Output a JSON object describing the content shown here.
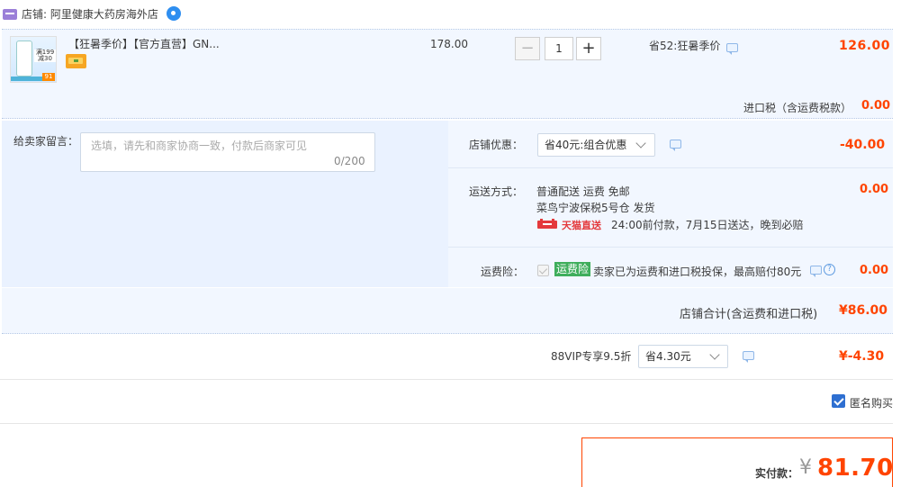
{
  "shop": {
    "name": "店铺: 阿里健康大药房海外店"
  },
  "item": {
    "title": "【狂暑季价】【官方直营】GN...",
    "thumb_label": "满199 减30",
    "thumb_badge": "91",
    "unit_price": "178.00",
    "quantity": "1",
    "promo": "省52:狂暑季价",
    "total": "126.00"
  },
  "tax": {
    "label": "进口税（含运费税款）",
    "value": "0.00"
  },
  "message": {
    "label": "给卖家留言：",
    "placeholder": "选填，请先和商家协商一致，付款后商家可见",
    "count": "0/200"
  },
  "shop_discount": {
    "label": "店铺优惠：",
    "selected": "省40元:组合优惠",
    "value": "-40.00"
  },
  "shipping": {
    "label": "运送方式：",
    "line1": "普通配送 运费 免邮",
    "line2": "菜鸟宁波保税5号仓   发货",
    "tmall_tag": "天猫直送",
    "line3": "24:00前付款，7月15日送达，晚到必赔",
    "value": "0.00"
  },
  "insurance": {
    "label": "运费险：",
    "tag": "运费险",
    "desc": "卖家已为运费和进口税投保，最高赔付80元",
    "value": "0.00"
  },
  "shop_total": {
    "label": "店铺合计(含运费和进口税)",
    "value": "¥86.00"
  },
  "vip": {
    "label": "88VIP专享9.5折",
    "selected": "省4.30元",
    "value": "¥-4.30"
  },
  "anonymous": {
    "label": "匿名购买",
    "checked": true
  },
  "payment": {
    "label": "实付款：",
    "symbol": "¥",
    "amount": "81.70"
  },
  "colors": {
    "price_red": "#ff4400",
    "panel_blue": "#f2f7ff",
    "msg_blue": "#eaf2ff",
    "check_blue": "#2e6fd1",
    "ins_green": "#3fae5c"
  }
}
